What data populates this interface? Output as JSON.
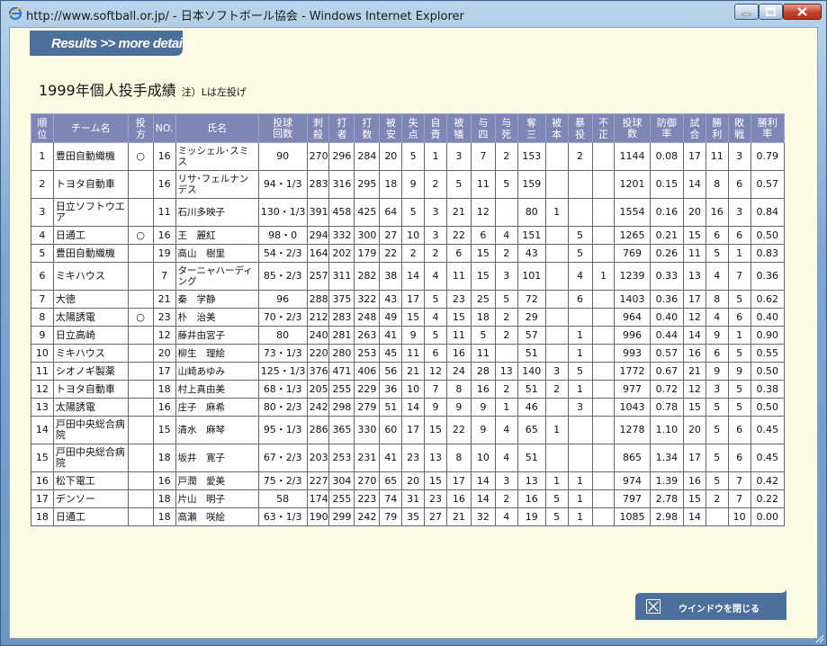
{
  "window": {
    "title": "http://www.softball.or.jp/ - 日本ソフトボール協会 - Windows Internet Explorer"
  },
  "header": {
    "label": "Results >> more details"
  },
  "page": {
    "title": "1999年個人投手成績",
    "note": "注）Lは左投げ"
  },
  "table": {
    "columns": [
      "順位",
      "チーム名",
      "投方",
      "NO.",
      "氏名",
      "投球回数",
      "刺殺",
      "打者",
      "打数",
      "被安",
      "失点",
      "自責",
      "被犠",
      "与四",
      "与死",
      "奪三",
      "被本",
      "暴投",
      "不正",
      "投球数",
      "防御率",
      "試合",
      "勝利",
      "敗戦",
      "勝利率"
    ],
    "rows": [
      [
        "1",
        "豊田自動織機",
        "○",
        "16",
        "ミッシェル･スミス",
        "90",
        "270",
        "296",
        "284",
        "20",
        "5",
        "1",
        "3",
        "7",
        "2",
        "153",
        "",
        "2",
        "",
        "1144",
        "0.08",
        "17",
        "11",
        "3",
        "0.79"
      ],
      [
        "2",
        "トヨタ自動車",
        "",
        "16",
        "リサ･フェルナンデス",
        "94・1/3",
        "283",
        "316",
        "295",
        "18",
        "9",
        "2",
        "5",
        "11",
        "5",
        "159",
        "",
        "",
        "",
        "1201",
        "0.15",
        "14",
        "8",
        "6",
        "0.57"
      ],
      [
        "3",
        "日立ソフトウエア",
        "",
        "11",
        "石川多映子",
        "130・1/3",
        "391",
        "458",
        "425",
        "64",
        "5",
        "3",
        "21",
        "12",
        "",
        "80",
        "1",
        "",
        "",
        "1554",
        "0.16",
        "20",
        "16",
        "3",
        "0.84"
      ],
      [
        "4",
        "日通工",
        "○",
        "16",
        "王　麗紅",
        "98・0",
        "294",
        "332",
        "300",
        "27",
        "10",
        "3",
        "22",
        "6",
        "4",
        "151",
        "",
        "5",
        "",
        "1265",
        "0.21",
        "15",
        "6",
        "6",
        "0.50"
      ],
      [
        "5",
        "豊田自動織機",
        "",
        "19",
        "高山　樹里",
        "54・2/3",
        "164",
        "202",
        "179",
        "22",
        "2",
        "2",
        "6",
        "15",
        "2",
        "43",
        "",
        "5",
        "",
        "769",
        "0.26",
        "11",
        "5",
        "1",
        "0.83"
      ],
      [
        "6",
        "ミキハウス",
        "",
        "7",
        "ターニャハーディング",
        "85・2/3",
        "257",
        "311",
        "282",
        "38",
        "14",
        "4",
        "11",
        "15",
        "3",
        "101",
        "",
        "4",
        "1",
        "1239",
        "0.33",
        "13",
        "4",
        "7",
        "0.36"
      ],
      [
        "7",
        "大徳",
        "",
        "21",
        "秦　学静",
        "96",
        "288",
        "375",
        "322",
        "43",
        "17",
        "5",
        "23",
        "25",
        "5",
        "72",
        "",
        "6",
        "",
        "1403",
        "0.36",
        "17",
        "8",
        "5",
        "0.62"
      ],
      [
        "8",
        "太陽誘電",
        "○",
        "23",
        "朴　治美",
        "70・2/3",
        "212",
        "283",
        "248",
        "49",
        "15",
        "4",
        "15",
        "18",
        "2",
        "29",
        "",
        "",
        "",
        "964",
        "0.40",
        "12",
        "4",
        "6",
        "0.40"
      ],
      [
        "9",
        "日立高崎",
        "",
        "12",
        "藤井由宮子",
        "80",
        "240",
        "281",
        "263",
        "41",
        "9",
        "5",
        "11",
        "5",
        "2",
        "57",
        "",
        "1",
        "",
        "996",
        "0.44",
        "14",
        "9",
        "1",
        "0.90"
      ],
      [
        "10",
        "ミキハウス",
        "",
        "20",
        "柳生　理絵",
        "73・1/3",
        "220",
        "280",
        "253",
        "45",
        "11",
        "6",
        "16",
        "11",
        "",
        "51",
        "",
        "1",
        "",
        "993",
        "0.57",
        "16",
        "6",
        "5",
        "0.55"
      ],
      [
        "11",
        "シオノギ製薬",
        "",
        "17",
        "山崎あゆみ",
        "125・1/3",
        "376",
        "471",
        "406",
        "56",
        "21",
        "12",
        "24",
        "28",
        "13",
        "140",
        "3",
        "5",
        "",
        "1772",
        "0.67",
        "21",
        "9",
        "9",
        "0.50"
      ],
      [
        "12",
        "トヨタ自動車",
        "",
        "18",
        "村上真由美",
        "68・1/3",
        "205",
        "255",
        "229",
        "36",
        "10",
        "7",
        "8",
        "16",
        "2",
        "51",
        "2",
        "1",
        "",
        "977",
        "0.72",
        "12",
        "3",
        "5",
        "0.38"
      ],
      [
        "13",
        "太陽誘電",
        "",
        "16",
        "庄子　麻希",
        "80・2/3",
        "242",
        "298",
        "279",
        "51",
        "14",
        "9",
        "9",
        "9",
        "1",
        "46",
        "",
        "3",
        "",
        "1043",
        "0.78",
        "15",
        "5",
        "5",
        "0.50"
      ],
      [
        "14",
        "戸田中央総合病院",
        "",
        "15",
        "清水　麻琴",
        "95・1/3",
        "286",
        "365",
        "330",
        "60",
        "17",
        "15",
        "22",
        "9",
        "4",
        "65",
        "1",
        "",
        "",
        "1278",
        "1.10",
        "20",
        "5",
        "6",
        "0.45"
      ],
      [
        "15",
        "戸田中央総合病院",
        "",
        "18",
        "坂井　寛子",
        "67・2/3",
        "203",
        "253",
        "231",
        "41",
        "23",
        "13",
        "8",
        "10",
        "4",
        "51",
        "",
        "",
        "",
        "865",
        "1.34",
        "17",
        "5",
        "6",
        "0.45"
      ],
      [
        "16",
        "松下電工",
        "",
        "16",
        "戸潤　愛美",
        "75・2/3",
        "227",
        "304",
        "270",
        "65",
        "20",
        "15",
        "17",
        "14",
        "3",
        "13",
        "1",
        "1",
        "",
        "974",
        "1.39",
        "16",
        "5",
        "7",
        "0.42"
      ],
      [
        "17",
        "デンソー",
        "",
        "18",
        "片山　明子",
        "58",
        "174",
        "255",
        "223",
        "74",
        "31",
        "23",
        "16",
        "14",
        "2",
        "16",
        "5",
        "1",
        "",
        "797",
        "2.78",
        "15",
        "2",
        "7",
        "0.22"
      ],
      [
        "18",
        "日通工",
        "",
        "18",
        "高瀬　咲絵",
        "63・1/3",
        "190",
        "299",
        "242",
        "79",
        "35",
        "27",
        "21",
        "32",
        "4",
        "19",
        "5",
        "1",
        "",
        "1085",
        "2.98",
        "14",
        "",
        "10",
        "0.00"
      ]
    ]
  },
  "footer": {
    "close_label": "ウインドウを閉じる"
  },
  "colors": {
    "header_bg": "#7e86b6",
    "page_bg": "#fbfbe3",
    "tab_bg": "#4d6f9c"
  },
  "icons": [
    "ie-icon",
    "minimize-icon",
    "maximize-icon",
    "close-icon",
    "close-x-icon"
  ]
}
